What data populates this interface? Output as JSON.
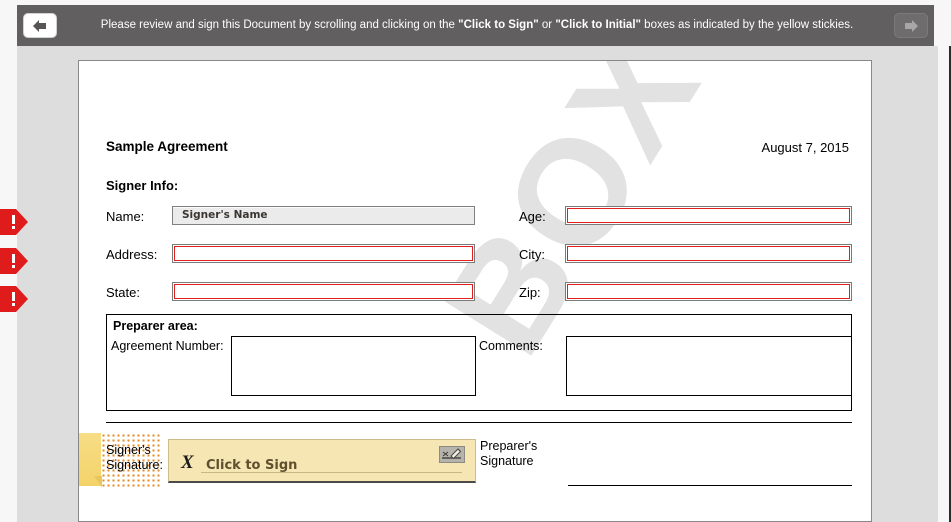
{
  "banner": {
    "text_before": "Please review and sign this Document by scrolling and clicking on the ",
    "strong_1": "\"Click to Sign\"",
    "text_middle": " or ",
    "strong_2": "\"Click to Initial\"",
    "text_after": " boxes as indicated by the yellow stickies.",
    "prev_label": "Previous",
    "next_label": "Next"
  },
  "document": {
    "watermark": "BOX",
    "title": "Sample Agreement",
    "date": "August 7, 2015",
    "signer_section_label": "Signer Info:",
    "fields": [
      {
        "label": "Name:",
        "value": "Signer's Name",
        "state": "filled-disabled"
      },
      {
        "label": "Age:",
        "value": "",
        "state": "required"
      },
      {
        "label": "Address:",
        "value": "",
        "state": "required"
      },
      {
        "label": "City:",
        "value": "",
        "state": "required"
      },
      {
        "label": "State:",
        "value": "",
        "state": "required"
      },
      {
        "label": "Zip:",
        "value": "",
        "state": "required"
      }
    ],
    "preparer": {
      "title": "Preparer area:",
      "agreement_number_label": "Agreement Number:",
      "agreement_number_value": "",
      "comments_label": "Comments:",
      "comments_value": ""
    },
    "signatures": {
      "signer_label": "Signer's\nSignature:",
      "signer_label_line1": "Signer's",
      "signer_label_line2": "Signature:",
      "sign_button_text": "Click to Sign",
      "sign_button_mark": "X",
      "preparer_label_line1": "Preparer's",
      "preparer_label_line2": "Signature"
    }
  },
  "alerts": {
    "count": 3,
    "glyph": "!",
    "color": "#e01b1b"
  },
  "colors": {
    "banner_bg": "#615f5f",
    "required_border": "#e31e1e",
    "sticky": "#f3d268",
    "sign_button_bg": "#f6e6b4",
    "page_bg": "#ffffff",
    "viewer_bg": "#dddddd"
  }
}
